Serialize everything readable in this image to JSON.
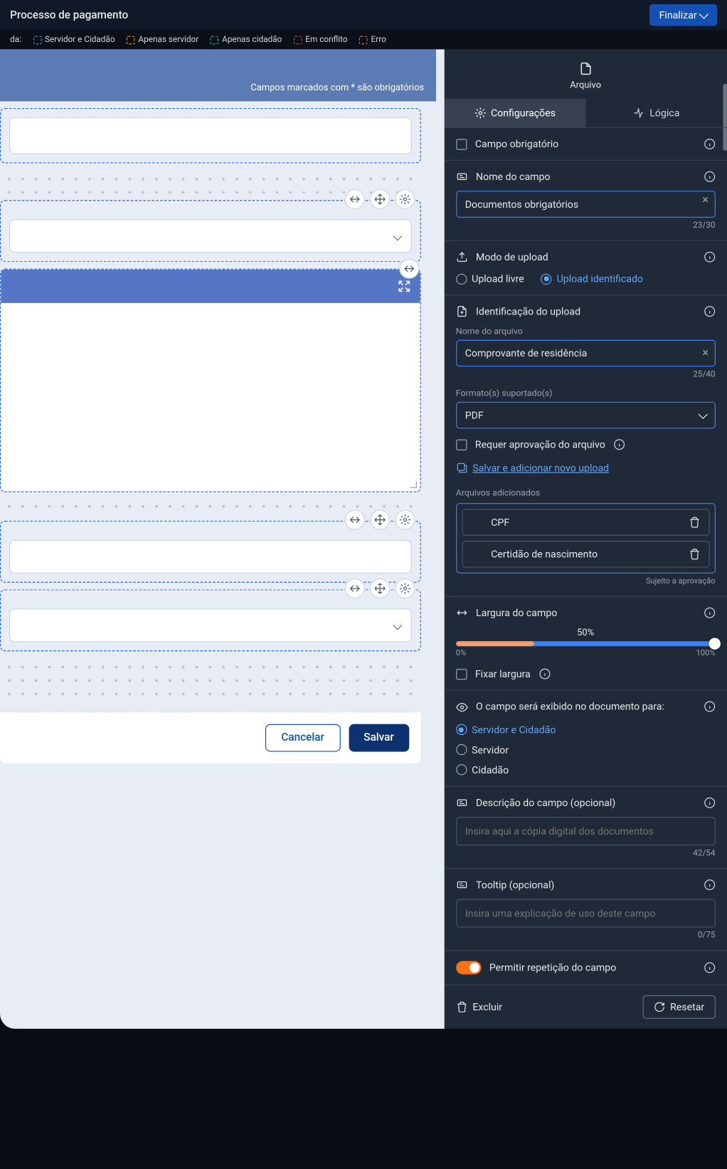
{
  "topbar": {
    "title": "Processo de pagamento",
    "finalize": "Finalizar"
  },
  "legend": {
    "prefix": "da:",
    "items": [
      {
        "label": "Servidor e Cidadão",
        "color": "#3b82f6"
      },
      {
        "label": "Apenas servidor",
        "color": "#f59e0b"
      },
      {
        "label": "Apenas cidadão",
        "color": "#14b8a6"
      },
      {
        "label": "Em conflito",
        "color": "#ef4444"
      },
      {
        "label": "Erro",
        "color": "#f97316"
      }
    ]
  },
  "canvas": {
    "required_hint": "Campos marcados com * são obrigatórios",
    "cancel": "Cancelar",
    "save": "Salvar"
  },
  "sidebar": {
    "header": "Arquivo",
    "tabs": {
      "config": "Configurações",
      "logic": "Lógica"
    },
    "required_field": "Campo obrigatório",
    "field_name": {
      "label": "Nome do campo",
      "value": "Documentos obrigatórios",
      "counter": "23/30"
    },
    "upload_mode": {
      "label": "Modo de upload",
      "free": "Upload livre",
      "identified": "Upload identificado"
    },
    "upload_id": {
      "label": "Identificação do upload",
      "file_name_label": "Nome do arquivo",
      "file_name_value": "Comprovante de residência",
      "file_name_counter": "25/40",
      "format_label": "Formato(s) suportado(s)",
      "format_value": "PDF",
      "require_approval": "Requer aprovação do arquivo",
      "save_add": "Salvar e adicionar novo upload",
      "added_label": "Arquivos adicionados",
      "files": [
        "CPF",
        "Certidão de nascimento"
      ],
      "approval_note": "Sujeito a aprovação"
    },
    "width": {
      "label": "Largura do campo",
      "value": "50%",
      "min": "0%",
      "max": "100%",
      "fix": "Fixar largura"
    },
    "visibility": {
      "label": "O campo será exibido no documento para:",
      "opt_both": "Servidor e Cidadão",
      "opt_server": "Servidor",
      "opt_citizen": "Cidadão"
    },
    "description": {
      "label": "Descrição do campo (opcional)",
      "placeholder": "Insira aqui a cópia digital dos documentos",
      "counter": "42/54"
    },
    "tooltip": {
      "label": "Tooltip (opcional)",
      "placeholder": "Insira uma explicação de uso deste campo",
      "counter": "0/75"
    },
    "repeat": "Permitir repetição do campo",
    "footer": {
      "delete": "Excluir",
      "reset": "Resetar"
    }
  }
}
